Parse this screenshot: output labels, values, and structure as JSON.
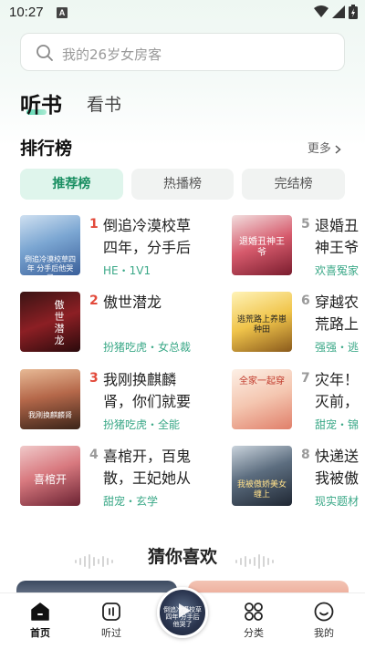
{
  "status": {
    "time": "10:27",
    "indicator": "A"
  },
  "search": {
    "placeholder": "我的26岁女房客"
  },
  "tabs": [
    {
      "label": "听书",
      "active": true
    },
    {
      "label": "看书",
      "active": false
    }
  ],
  "ranking": {
    "title": "排行榜",
    "more": "更多",
    "filters": [
      {
        "label": "推荐榜",
        "active": true
      },
      {
        "label": "热播榜",
        "active": false
      },
      {
        "label": "完结榜",
        "active": false
      }
    ],
    "left": [
      {
        "rank": "1",
        "title": "倒追冷漠校草四年，分手后",
        "tags": "HE・1V1",
        "cover_caption": "倒追冷漠校草四年 分手后他哭了"
      },
      {
        "rank": "2",
        "title": "傲世潜龙",
        "tags": "扮猪吃虎・女总裁",
        "cover_caption": "傲世潜龙"
      },
      {
        "rank": "3",
        "title": "我刚换麒麟肾，你们就要",
        "tags": "扮猪吃虎・全能",
        "cover_caption": "我刚换麒麟肾"
      },
      {
        "rank": "4",
        "title": "喜棺开，百鬼散，王妃她从",
        "tags": "甜宠・玄学",
        "cover_caption": "喜棺开"
      }
    ],
    "right": [
      {
        "rank": "5",
        "title": "退婚丑神王爷",
        "tags": "欢喜冤家",
        "cover_caption": "退婚丑神王爷"
      },
      {
        "rank": "6",
        "title": "穿越农荒路上",
        "tags": "强强・逃",
        "cover_caption": "逃荒路上养崽种田"
      },
      {
        "rank": "7",
        "title": "灾年！灭前，",
        "tags": "甜宠・锦",
        "cover_caption": "全家一起穿"
      },
      {
        "rank": "8",
        "title": "快递送我被傲",
        "tags": "现实题材",
        "cover_caption": "我被傲娇美女缠上"
      }
    ]
  },
  "guess": {
    "title": "猜你喜欢"
  },
  "nav": [
    {
      "label": "首页",
      "icon": "home-icon",
      "active": true
    },
    {
      "label": "听过",
      "icon": "history-icon",
      "active": false
    },
    {
      "label": "分类",
      "icon": "category-icon",
      "active": false
    },
    {
      "label": "我的",
      "icon": "profile-icon",
      "active": false
    }
  ],
  "player": {
    "cover_caption": "倒追冷漠校草四年 分手后他哭了"
  },
  "colors": {
    "accent": "#1a8f62",
    "rank_hot": "#e24a3b",
    "tag": "#3aa887"
  }
}
